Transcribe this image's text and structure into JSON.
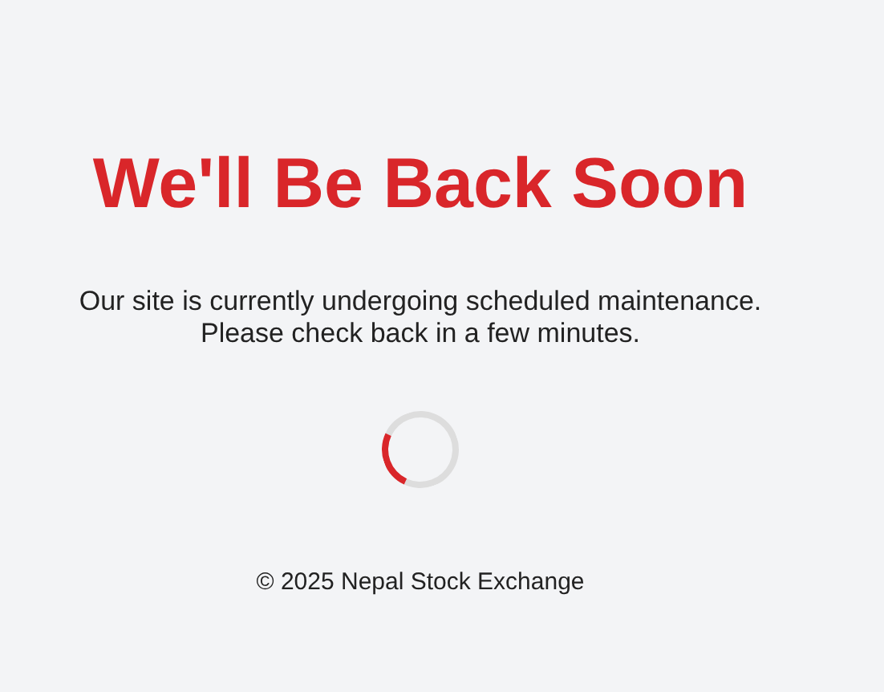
{
  "title": "We'll Be Back Soon",
  "message": [
    "Our site is currently undergoing scheduled maintenance.",
    "Please check back in a few minutes."
  ],
  "footer": "© 2025 Nepal Stock Exchange"
}
